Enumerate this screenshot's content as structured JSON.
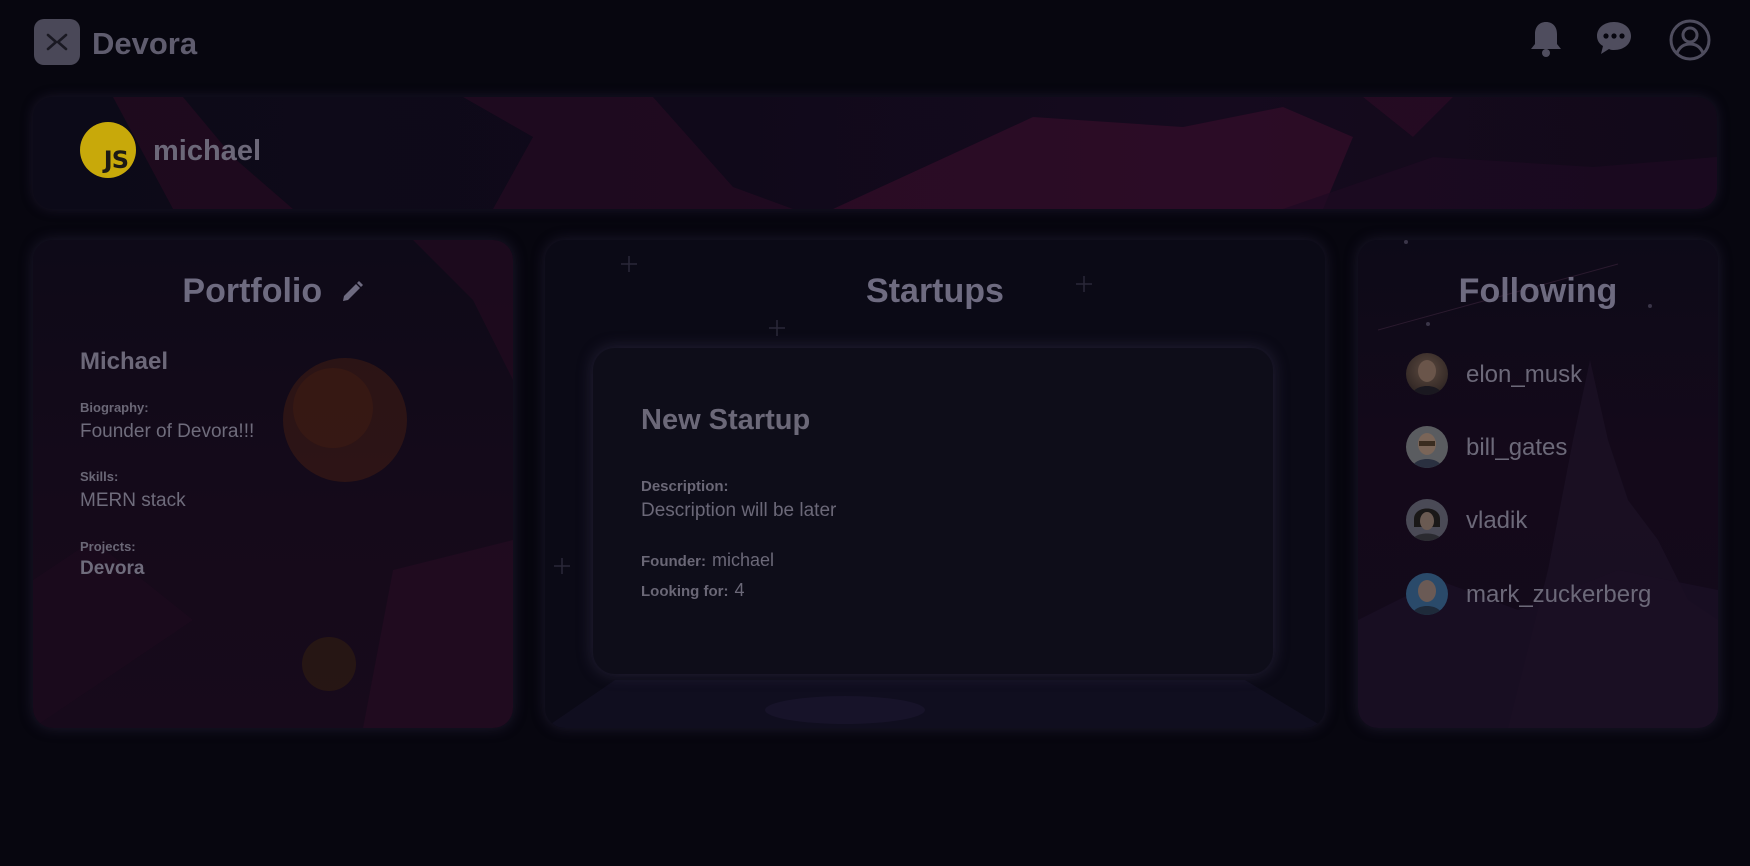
{
  "header": {
    "brand": "Devora",
    "icons": [
      "bell-icon",
      "chat-icon",
      "user-circle-icon"
    ]
  },
  "banner": {
    "username": "michael",
    "avatar_text": "JS"
  },
  "portfolio": {
    "title": "Portfolio",
    "name": "Michael",
    "biography_label": "Biography:",
    "biography": "Founder of Devora!!!",
    "skills_label": "Skills:",
    "skills": "MERN stack",
    "projects_label": "Projects:",
    "projects": "Devora"
  },
  "startups": {
    "title": "Startups",
    "items": [
      {
        "name": "New Startup",
        "description_label": "Description:",
        "description": "Description will be later",
        "founder_label": "Founder:",
        "founder": "michael",
        "looking_for_label": "Looking for:",
        "looking_for": "4"
      }
    ]
  },
  "following": {
    "title": "Following",
    "users": [
      {
        "name": "elon_musk"
      },
      {
        "name": "bill_gates"
      },
      {
        "name": "vladik"
      },
      {
        "name": "mark_zuckerberg"
      }
    ]
  },
  "colors": {
    "background": "#07060f",
    "avatar_yellow": "#c8a90a",
    "accent_pink": "#3a0f2a"
  }
}
